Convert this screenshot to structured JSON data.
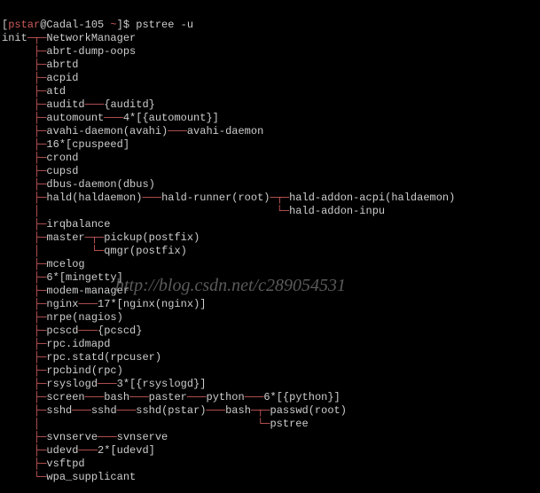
{
  "prompt": {
    "user": "pstar",
    "host": "Cadal-105",
    "path": "~",
    "symbol": "$",
    "command": "pstree -u"
  },
  "tree": {
    "root": "init",
    "children": [
      {
        "label": "NetworkManager"
      },
      {
        "label": "abrt-dump-oops"
      },
      {
        "label": "abrtd"
      },
      {
        "label": "acpid"
      },
      {
        "label": "atd"
      },
      {
        "label": "auditd",
        "children": [
          {
            "label": "{auditd}"
          }
        ]
      },
      {
        "label": "automount",
        "children": [
          {
            "label": "4*[{automount}]"
          }
        ]
      },
      {
        "label": "avahi-daemon(avahi)",
        "children": [
          {
            "label": "avahi-daemon"
          }
        ]
      },
      {
        "label": "16*[cpuspeed]"
      },
      {
        "label": "crond"
      },
      {
        "label": "cupsd"
      },
      {
        "label": "dbus-daemon(dbus)"
      },
      {
        "label": "hald(haldaemon)",
        "children": [
          {
            "label": "hald-runner(root)",
            "children": [
              {
                "label": "hald-addon-acpi(haldaemon)"
              },
              {
                "label": "hald-addon-inpu"
              }
            ]
          }
        ]
      },
      {
        "label": "irqbalance"
      },
      {
        "label": "master",
        "children": [
          {
            "label": "pickup(postfix)"
          },
          {
            "label": "qmgr(postfix)"
          }
        ]
      },
      {
        "label": "mcelog"
      },
      {
        "label": "6*[mingetty]"
      },
      {
        "label": "modem-manager"
      },
      {
        "label": "nginx",
        "children": [
          {
            "label": "17*[nginx(nginx)]"
          }
        ]
      },
      {
        "label": "nrpe(nagios)"
      },
      {
        "label": "pcscd",
        "children": [
          {
            "label": "{pcscd}"
          }
        ]
      },
      {
        "label": "rpc.idmapd"
      },
      {
        "label": "rpc.statd(rpcuser)"
      },
      {
        "label": "rpcbind(rpc)"
      },
      {
        "label": "rsyslogd",
        "children": [
          {
            "label": "3*[{rsyslogd}]"
          }
        ]
      },
      {
        "label": "screen",
        "children": [
          {
            "label": "bash",
            "children": [
              {
                "label": "paster",
                "children": [
                  {
                    "label": "python",
                    "children": [
                      {
                        "label": "6*[{python}]"
                      }
                    ]
                  }
                ]
              }
            ]
          }
        ]
      },
      {
        "label": "sshd",
        "children": [
          {
            "label": "sshd",
            "children": [
              {
                "label": "sshd(pstar)",
                "children": [
                  {
                    "label": "bash",
                    "children": [
                      {
                        "label": "passwd(root)"
                      },
                      {
                        "label": "pstree"
                      }
                    ]
                  }
                ]
              }
            ]
          }
        ]
      },
      {
        "label": "svnserve",
        "children": [
          {
            "label": "svnserve"
          }
        ]
      },
      {
        "label": "udevd",
        "children": [
          {
            "label": "2*[udevd]"
          }
        ]
      },
      {
        "label": "vsftpd"
      },
      {
        "label": "wpa_supplicant"
      }
    ]
  },
  "watermark": "http://blog.csdn.net/c289054531"
}
